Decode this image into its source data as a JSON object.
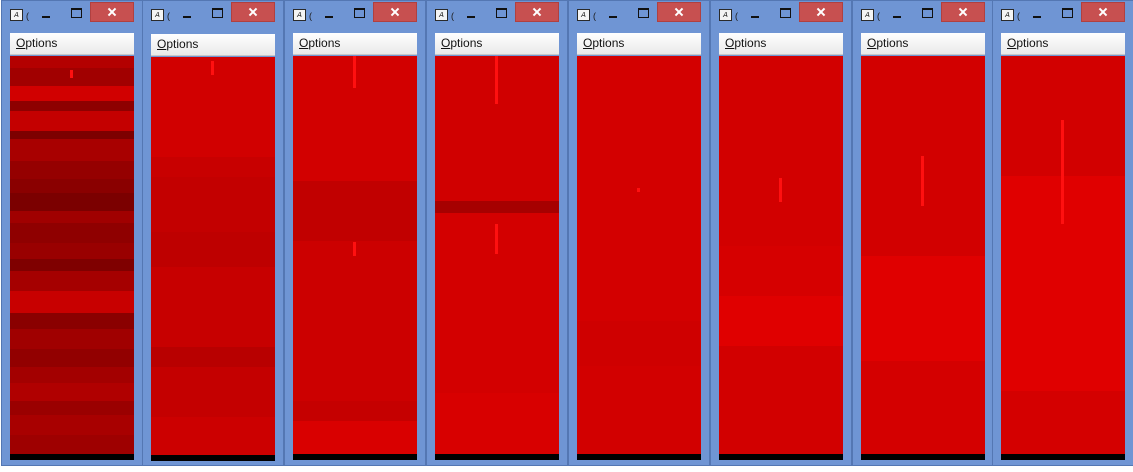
{
  "windows": [
    {
      "menu_label": "Options",
      "min_glyph": "–",
      "max_glyph": "□",
      "close_glyph": "✕"
    },
    {
      "menu_label": "Options",
      "min_glyph": "–",
      "max_glyph": "□",
      "close_glyph": "✕"
    },
    {
      "menu_label": "Options",
      "min_glyph": "–",
      "max_glyph": "□",
      "close_glyph": "✕"
    },
    {
      "menu_label": "Options",
      "min_glyph": "–",
      "max_glyph": "□",
      "close_glyph": "✕"
    },
    {
      "menu_label": "Options",
      "min_glyph": "–",
      "max_glyph": "□",
      "close_glyph": "✕"
    },
    {
      "menu_label": "Options",
      "min_glyph": "–",
      "max_glyph": "□",
      "close_glyph": "✕"
    },
    {
      "menu_label": "Options",
      "min_glyph": "–",
      "max_glyph": "□",
      "close_glyph": "✕"
    },
    {
      "menu_label": "Options",
      "min_glyph": "–",
      "max_glyph": "□",
      "close_glyph": "✕"
    }
  ],
  "app_icon_text": "A",
  "icons": {
    "app": "java-app-icon",
    "minimize": "minimize-icon",
    "maximize": "maximize-icon",
    "close": "close-icon"
  },
  "colors": {
    "titlebar": "#6f95d4",
    "close_button": "#c75050",
    "canvas_red": "#d10000",
    "canvas_dark_red": "#8a0000",
    "highlight_red": "#ff1010"
  }
}
